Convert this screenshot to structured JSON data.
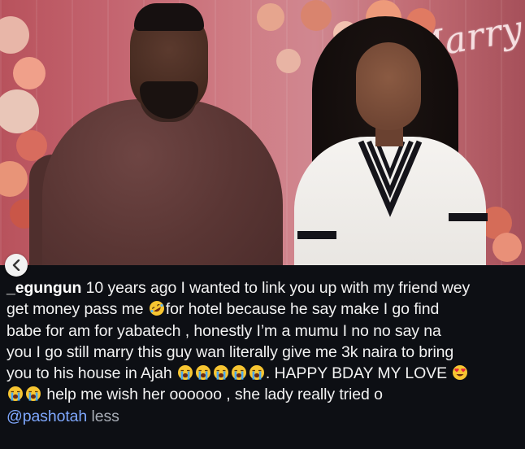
{
  "photo": {
    "sign_text": "Marry",
    "description_icons": [
      "back-arrow-icon"
    ]
  },
  "caption": {
    "username": "_egungun",
    "line1_rest": " 10 years ago I wanted to link you up with my friend wey",
    "line2_a": "get money pass me ",
    "line2_b": "for hotel because he say make I go find",
    "line3": "babe for am for yabatech , honestly I’m a mumu I no no say na",
    "line4": "you I go still marry this guy wan literally give me 3k naira to bring",
    "line5_a": "you to his house in Ajah ",
    "line5_b": ". HAPPY BDAY MY LOVE ",
    "line6_b": " help me wish her oooooo , she lady really tried o",
    "mention": "@pashotah",
    "less": "less"
  },
  "emoji": {
    "rofl": "rofl-emoji",
    "crying": "loudly-crying-emoji",
    "heart_eyes": "heart-eyes-emoji"
  },
  "colors": {
    "background": "#0d0f14",
    "text": "#f2f2f2",
    "mention": "#7fa8ff",
    "muted": "#a8adb6"
  }
}
